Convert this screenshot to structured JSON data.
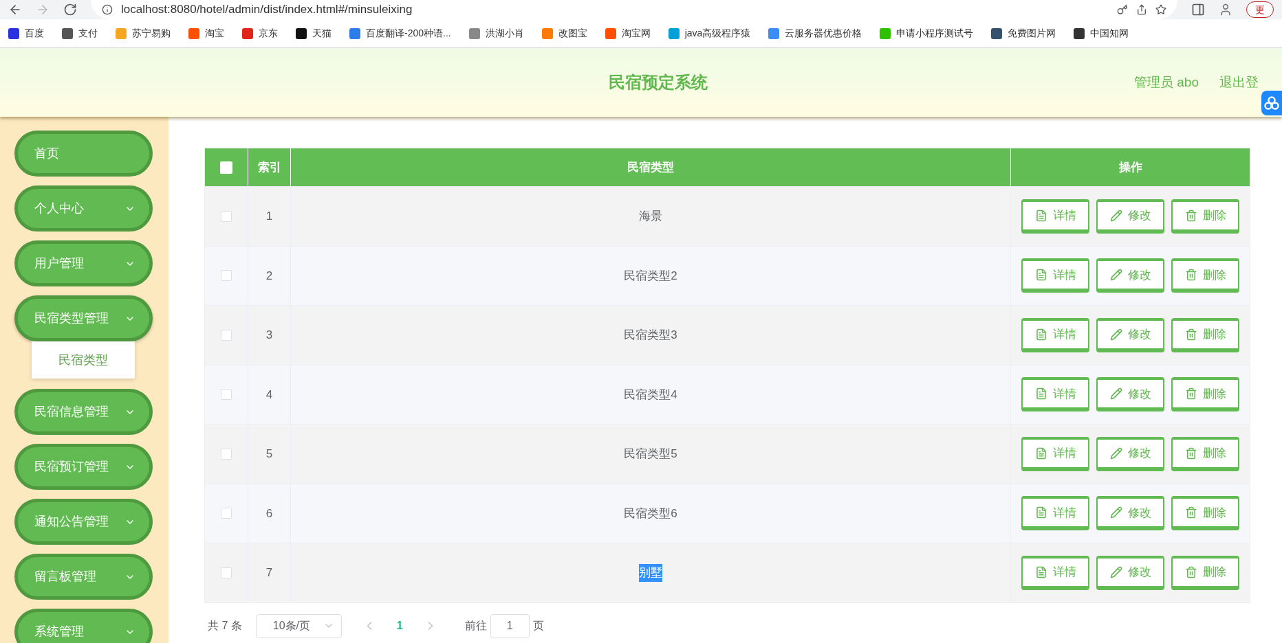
{
  "browser": {
    "url": "localhost:8080/hotel/admin/dist/index.html#/minsuleixing",
    "update_button": "更",
    "bookmarks": [
      {
        "label": "百度",
        "color": "#2932e1"
      },
      {
        "label": "支付",
        "color": "#555555"
      },
      {
        "label": "苏宁易购",
        "color": "#f5a623"
      },
      {
        "label": "淘宝",
        "color": "#ff5000"
      },
      {
        "label": "京东",
        "color": "#e1251b"
      },
      {
        "label": "天猫",
        "color": "#111111"
      },
      {
        "label": "百度翻译-200种语...",
        "color": "#2b7de9"
      },
      {
        "label": "洪湖小肖",
        "color": "#888888"
      },
      {
        "label": "改图宝",
        "color": "#ff7a00"
      },
      {
        "label": "淘宝网",
        "color": "#ff5000"
      },
      {
        "label": "java高级程序猿",
        "color": "#00a1d6"
      },
      {
        "label": "云服务器优惠价格",
        "color": "#3b8cf5"
      },
      {
        "label": "申请小程序测试号",
        "color": "#2dc100"
      },
      {
        "label": "免费图片网",
        "color": "#34526f"
      },
      {
        "label": "中国知网",
        "color": "#333333"
      }
    ]
  },
  "header": {
    "title": "民宿预定系统",
    "user": "管理员 abo",
    "logout": "退出登"
  },
  "sidebar": {
    "items": [
      {
        "label": "首页",
        "kind": "link",
        "expanded": false
      },
      {
        "label": "个人中心",
        "kind": "submenu",
        "expanded": false
      },
      {
        "label": "用户管理",
        "kind": "submenu",
        "expanded": false
      },
      {
        "label": "民宿类型管理",
        "kind": "submenu",
        "expanded": true,
        "children": [
          {
            "label": "民宿类型"
          }
        ]
      },
      {
        "label": "民宿信息管理",
        "kind": "submenu",
        "expanded": false
      },
      {
        "label": "民宿预订管理",
        "kind": "submenu",
        "expanded": false
      },
      {
        "label": "通知公告管理",
        "kind": "submenu",
        "expanded": false
      },
      {
        "label": "留言板管理",
        "kind": "submenu",
        "expanded": false
      },
      {
        "label": "系统管理",
        "kind": "submenu",
        "expanded": false
      }
    ]
  },
  "table": {
    "columns": [
      "索引",
      "民宿类型",
      "操作"
    ],
    "all_checked": false,
    "rows": [
      {
        "index": "1",
        "type": "海景",
        "checked": false,
        "text_selected": false,
        "actions": [
          "详情",
          "修改",
          "删除"
        ]
      },
      {
        "index": "2",
        "type": "民宿类型2",
        "checked": false,
        "text_selected": false,
        "actions": [
          "详情",
          "修改",
          "删除"
        ]
      },
      {
        "index": "3",
        "type": "民宿类型3",
        "checked": false,
        "text_selected": false,
        "actions": [
          "详情",
          "修改",
          "删除"
        ]
      },
      {
        "index": "4",
        "type": "民宿类型4",
        "checked": false,
        "text_selected": false,
        "actions": [
          "详情",
          "修改",
          "删除"
        ]
      },
      {
        "index": "5",
        "type": "民宿类型5",
        "checked": false,
        "text_selected": false,
        "actions": [
          "详情",
          "修改",
          "删除"
        ]
      },
      {
        "index": "6",
        "type": "民宿类型6",
        "checked": false,
        "text_selected": false,
        "actions": [
          "详情",
          "修改",
          "删除"
        ]
      },
      {
        "index": "7",
        "type": "别墅",
        "checked": false,
        "text_selected": true,
        "actions": [
          "详情",
          "修改",
          "删除"
        ]
      }
    ]
  },
  "pagination": {
    "total": "共 7 条",
    "page_size": "10条/页",
    "pages": [
      {
        "label": "1",
        "selected": true
      }
    ],
    "goto_label": "前往",
    "goto_value": "1",
    "goto_suffix": "页"
  }
}
